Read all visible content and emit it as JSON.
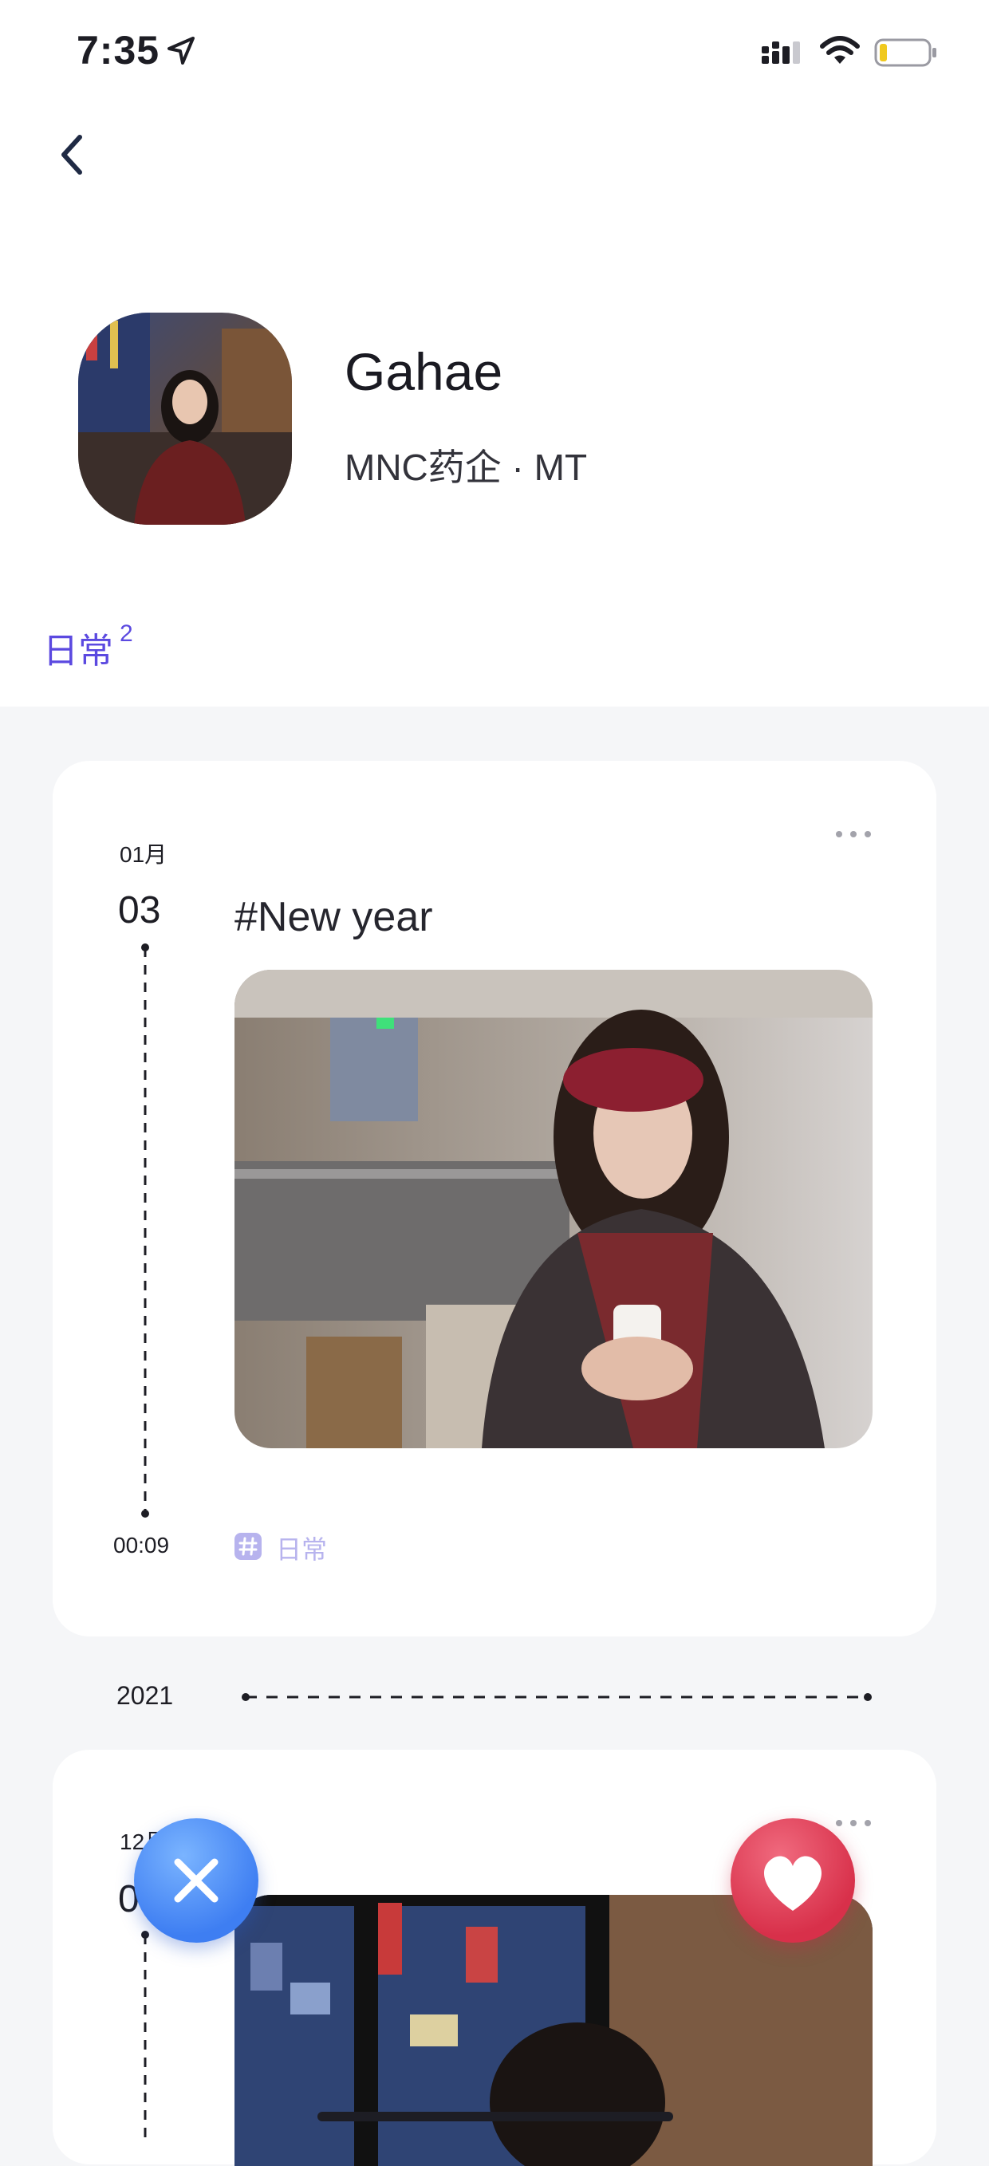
{
  "status_bar": {
    "time": "7:35",
    "icons": [
      "location-arrow-icon",
      "signal-icon",
      "wifi-icon",
      "battery-icon"
    ]
  },
  "nav": {
    "back_icon": "chevron-left-icon"
  },
  "profile": {
    "name": "Gahae",
    "subtitle": "MNC药企 · MT"
  },
  "tabs": [
    {
      "label": "日常",
      "count": "2",
      "active": true
    }
  ],
  "colors": {
    "accent": "#5b49e0",
    "tag": "#b7b3ee",
    "reject": "#3e7ef2",
    "like": "#d8304a"
  },
  "posts": [
    {
      "month": "01月",
      "day": "03",
      "end_time": "00:09",
      "title": "#New year",
      "tag": "日常",
      "more_icon": "more-dots-icon"
    },
    {
      "month": "12月",
      "day": "0",
      "more_icon": "more-dots-icon"
    }
  ],
  "year_divider": {
    "year": "2021"
  },
  "actions": {
    "reject_icon": "close-icon",
    "like_icon": "heart-icon"
  }
}
